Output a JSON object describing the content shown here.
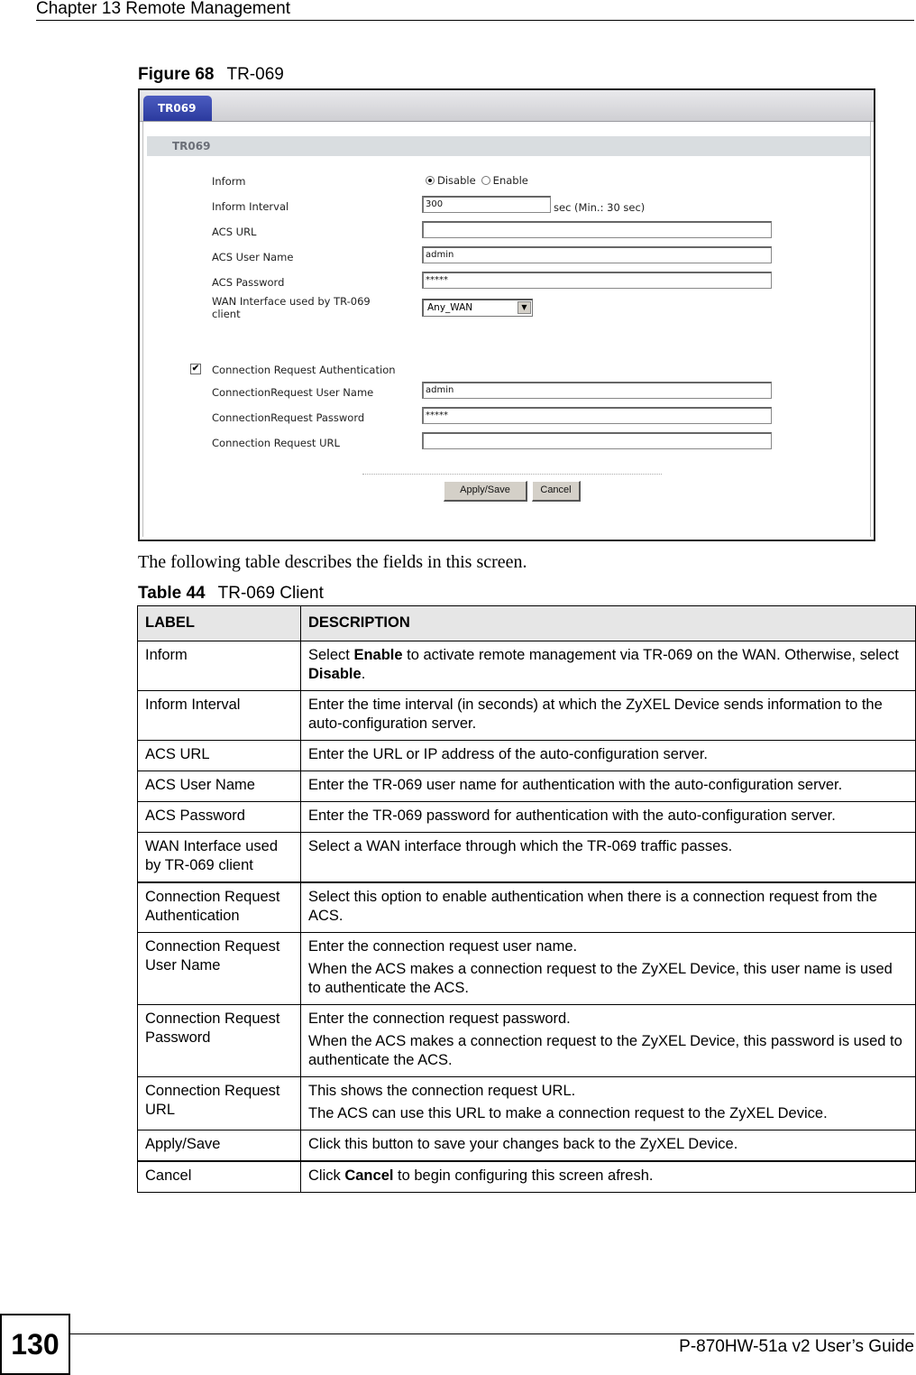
{
  "header": {
    "chapter": "Chapter 13 Remote Management"
  },
  "figure": {
    "number_label": "Figure 68",
    "title": "TR-069",
    "ui": {
      "tab_label": "TR069",
      "section_title": "TR069",
      "fields": {
        "inform": {
          "label": "Inform",
          "options": [
            "Disable",
            "Enable"
          ],
          "selected": "Disable"
        },
        "inform_interval": {
          "label": "Inform Interval",
          "value": "300",
          "unit_note": "sec  (Min.: 30 sec)"
        },
        "acs_url": {
          "label": "ACS URL",
          "value": ""
        },
        "acs_user_name": {
          "label": "ACS User Name",
          "value": "admin"
        },
        "acs_password": {
          "label": "ACS Password",
          "value": "*****"
        },
        "wan_interface": {
          "label_line1": "WAN Interface used by TR-069",
          "label_line2": "client",
          "value": "Any_WAN"
        },
        "conn_req_auth": {
          "label": "Connection Request Authentication",
          "checked": true,
          "check_glyph": "✔"
        },
        "conn_req_user": {
          "label": "ConnectionRequest User Name",
          "value": "admin"
        },
        "conn_req_password": {
          "label": "ConnectionRequest Password",
          "value": "*****"
        },
        "conn_req_url": {
          "label": "Connection Request URL",
          "value": ""
        }
      },
      "buttons": {
        "apply": "Apply/Save",
        "cancel": "Cancel"
      },
      "icons": {
        "dropdown_arrow": "▼"
      }
    }
  },
  "intro_text": "The following table describes the fields in this screen.",
  "table": {
    "number_label": "Table 44",
    "title": "TR-069 Client",
    "headers": [
      "LABEL",
      "DESCRIPTION"
    ],
    "rows": [
      {
        "label": "Inform",
        "desc": [
          {
            "pre": "Select ",
            "b1": "Enable",
            "mid": " to activate remote management via TR-069 on the WAN. Otherwise, select ",
            "b2": "Disable",
            "post": "."
          }
        ]
      },
      {
        "label": "Inform Interval",
        "desc": [
          "Enter the time interval (in seconds) at which the ZyXEL Device sends information to the auto-configuration server."
        ]
      },
      {
        "label": "ACS URL",
        "desc": [
          "Enter the URL or IP address of the auto-configuration server."
        ]
      },
      {
        "label": "ACS User Name",
        "desc": [
          "Enter the TR-069 user name for authentication with the auto-configuration server."
        ]
      },
      {
        "label": "ACS Password",
        "desc": [
          "Enter the TR-069 password for authentication with the auto-configuration server."
        ]
      },
      {
        "label": "WAN Interface used by TR-069 client",
        "desc": [
          "Select a WAN interface through which the TR-069 traffic passes."
        ]
      },
      {
        "label": "Connection Request Authentication",
        "desc": [
          "Select this option to enable authentication when there is a connection request from the ACS."
        ]
      },
      {
        "label": "Connection Request User Name",
        "desc": [
          "Enter the connection request user name.",
          "When the ACS makes a connection request to the ZyXEL Device, this user name is used to authenticate the ACS."
        ]
      },
      {
        "label": "Connection Request Password",
        "desc": [
          "Enter the connection request password.",
          "When the ACS makes a connection request to the ZyXEL Device, this password is used to authenticate the ACS."
        ]
      },
      {
        "label": "Connection Request URL",
        "desc": [
          "This shows the connection request URL.",
          "The ACS can use this URL to make a connection request to the ZyXEL Device."
        ]
      },
      {
        "label": "Apply/Save",
        "desc": [
          "Click this button to save your changes back to the ZyXEL Device."
        ]
      },
      {
        "label": "Cancel",
        "desc": [
          {
            "pre": "Click ",
            "b1": "Cancel",
            "mid": " to begin configuring this screen afresh.",
            "b2": "",
            "post": ""
          }
        ]
      }
    ]
  },
  "footer": {
    "page_number": "130",
    "guide_title": "P-870HW-51a v2 User’s Guide"
  }
}
